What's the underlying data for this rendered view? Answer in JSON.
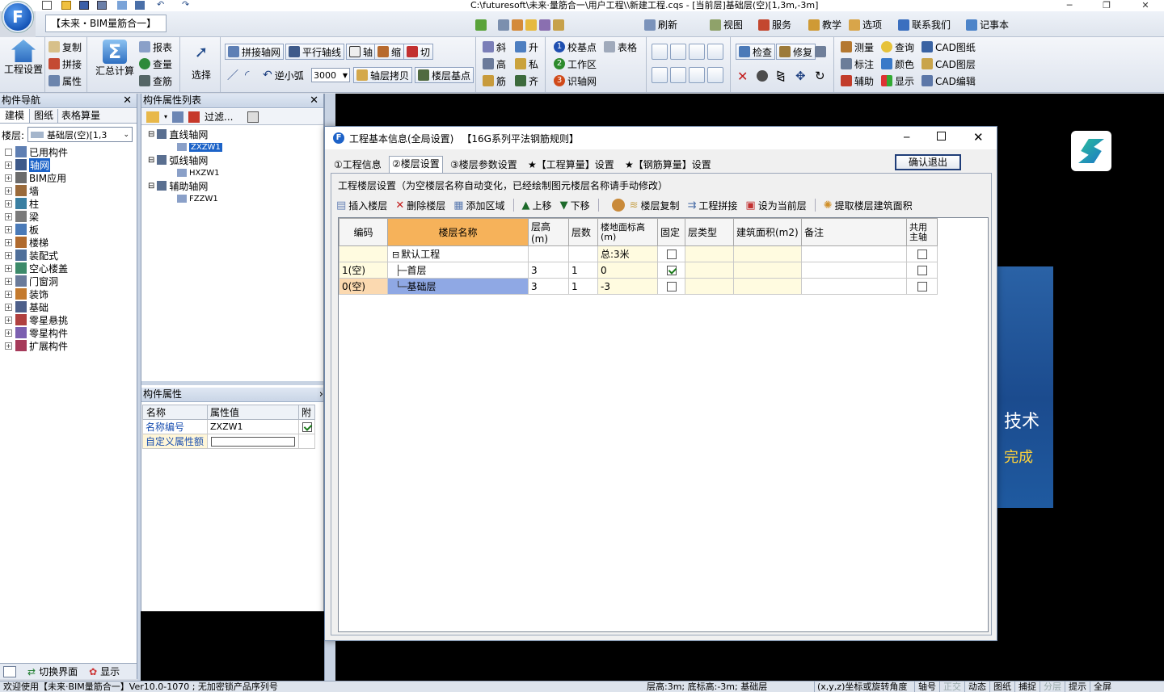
{
  "window": {
    "title": "C:\\futuresoft\\未来·量筋合一\\用户工程\\\\新建工程.cqs - [当前层]基础层(空)[1,3m,-3m]",
    "app_tab": "【未来・BIM量筋合一】",
    "logo_letter": "F"
  },
  "top_menu": [
    "刷新",
    "视图",
    "服务",
    "教学",
    "选项",
    "联系我们",
    "记事本"
  ],
  "ribbon": {
    "project": {
      "label": "工程设置"
    },
    "edit": {
      "copy": "复制",
      "merge": "拼接",
      "props": "属性"
    },
    "calc": {
      "label": "汇总计算"
    },
    "report": {
      "report": "报表",
      "check_qty": "查量",
      "check_bar": "查筋"
    },
    "select": {
      "label": "选择"
    },
    "axis": {
      "merge_grid": "拼接轴网",
      "parallel": "平行轴线",
      "axis": "轴",
      "scale": "缩",
      "cut": "切",
      "arc": "逆小弧",
      "arc_value": "3000",
      "copy_axis": "轴层拷贝",
      "base_point": "楼层基点"
    },
    "misc": {
      "slant": "斜",
      "up": "升",
      "high": "高",
      "private": "私",
      "bar": "筋",
      "align": "齐"
    },
    "steps": {
      "step1": "校基点",
      "step2": "工作区",
      "step3": "识轴网",
      "table": "表格"
    },
    "tools": {
      "check": "检查",
      "repair": "修复"
    },
    "cad": {
      "measure": "测量",
      "query": "查询",
      "cad_drawing": "CAD图纸",
      "mark": "标注",
      "color": "颜色",
      "cad_layer": "CAD图层",
      "assist": "辅助",
      "display": "显示",
      "cad_edit": "CAD编辑"
    }
  },
  "left_panel": {
    "title": "构件导航",
    "tabs": [
      "建模",
      "图纸",
      "表格算量"
    ],
    "floor_label": "楼层:",
    "floor_value": "基础层(空)[1,3",
    "tree": [
      "已用构件",
      "轴网",
      "BIM应用",
      "墙",
      "柱",
      "梁",
      "板",
      "楼梯",
      "装配式",
      "空心楼盖",
      "门窗洞",
      "装饰",
      "基础",
      "零星悬挑",
      "零星构件",
      "扩展构件"
    ],
    "bottom": {
      "switch": "切换界面",
      "display": "显示"
    }
  },
  "mid_panel": {
    "title": "构件属性列表",
    "filter": "过滤...",
    "tree": [
      {
        "group": "直线轴网",
        "child": "ZXZW1"
      },
      {
        "group": "弧线轴网",
        "child": "HXZW1"
      },
      {
        "group": "辅助轴网",
        "child": "FZZW1"
      }
    ],
    "props_title": "构件属性",
    "props_headers": [
      "名称",
      "属性值",
      "附"
    ],
    "props_rows": [
      {
        "name": "名称编号",
        "value": "ZXZW1"
      },
      {
        "name": "自定义属性额",
        "value": ""
      }
    ]
  },
  "dialog": {
    "title": "工程基本信息(全局设置)",
    "subtitle": "【16G系列平法钢筋规则】",
    "confirm": "确认退出",
    "tabs": [
      "①工程信息",
      "②楼层设置",
      "③楼层参数设置",
      "★【工程算量】设置",
      "★【钢筋算量】设置"
    ],
    "hint": "工程楼层设置（为空楼层名称自动变化，已经绘制图元楼层名称请手动修改）",
    "toolbar": [
      "插入楼层",
      "删除楼层",
      "添加区域",
      "上移",
      "下移",
      "楼层复制",
      "工程拼接",
      "设为当前层",
      "提取楼层建筑面积"
    ],
    "columns": [
      "编码",
      "楼层名称",
      "层高(m)",
      "层数",
      "楼地面标高(m)",
      "固定",
      "层类型",
      "建筑面积(m2)",
      "备注",
      "共用主轴"
    ],
    "rows": [
      {
        "code": "",
        "name": "默认工程",
        "height": "",
        "count": "",
        "elev": "总:3米",
        "fixed": false,
        "shared": false
      },
      {
        "code": "1(空)",
        "name": "首层",
        "height": "3",
        "count": "1",
        "elev": "0",
        "fixed": true,
        "shared": false
      },
      {
        "code": "0(空)",
        "name": "基础层",
        "height": "3",
        "count": "1",
        "elev": "-3",
        "fixed": false,
        "shared": false
      }
    ]
  },
  "canvas": {
    "banner_text1": "技术",
    "banner_text2": "完成"
  },
  "status": {
    "left": "欢迎使用【未来·BIM量筋合一】Ver10.0-1070 ; 无加密锁产品序列号",
    "floor": "层高:3m; 底标高:-3m; 基础层",
    "coord": "(x,y,z)坐标或旋转角度",
    "toggles": [
      "轴号",
      "正交",
      "动态",
      "图纸",
      "捕捉",
      "分层",
      "提示",
      "全屏"
    ]
  },
  "colors": {
    "accent": "#3a78c8",
    "orange": "#f6b25a",
    "selected": "#8fa8e4",
    "highlight_yellow": "#fffbe0"
  }
}
